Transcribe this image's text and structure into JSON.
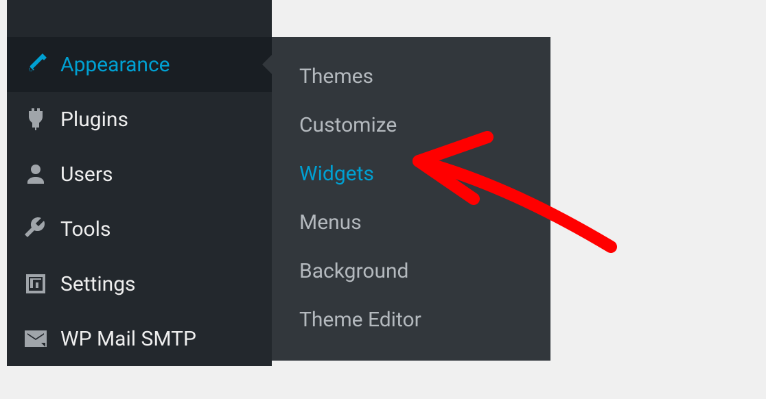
{
  "sidebar": {
    "items": [
      {
        "label": "Appearance",
        "icon": "brush-icon",
        "active": true
      },
      {
        "label": "Plugins",
        "icon": "plug-icon",
        "active": false
      },
      {
        "label": "Users",
        "icon": "user-icon",
        "active": false
      },
      {
        "label": "Tools",
        "icon": "wrench-icon",
        "active": false
      },
      {
        "label": "Settings",
        "icon": "sliders-icon",
        "active": false
      },
      {
        "label": "WP Mail SMTP",
        "icon": "mail-icon",
        "active": false
      }
    ]
  },
  "submenu": {
    "items": [
      {
        "label": "Themes",
        "active": false
      },
      {
        "label": "Customize",
        "active": false
      },
      {
        "label": "Widgets",
        "active": true
      },
      {
        "label": "Menus",
        "active": false
      },
      {
        "label": "Background",
        "active": false
      },
      {
        "label": "Theme Editor",
        "active": false
      }
    ]
  },
  "colors": {
    "sidebar_bg": "#23282d",
    "active_bg": "#191e23",
    "submenu_bg": "#32373c",
    "accent": "#00a0d2",
    "text": "#eeeeee",
    "muted": "#b4b9be",
    "annotation": "#ff0000"
  }
}
